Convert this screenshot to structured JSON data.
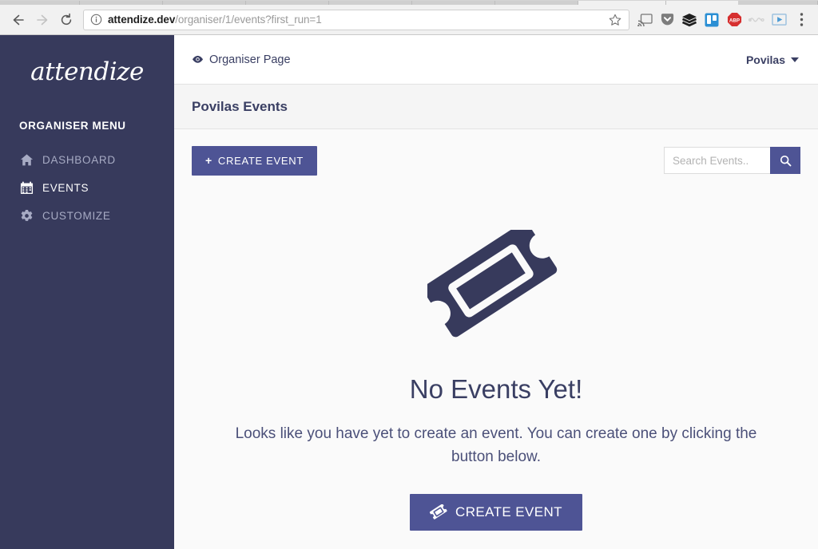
{
  "browser": {
    "back_label": "Back",
    "forward_label": "Forward",
    "reload_label": "Reload",
    "url_host": "attendize.dev",
    "url_path": "/organiser/1/events?first_run=1",
    "info_icon": "info-circle-icon",
    "bookmark_icon": "star-icon",
    "extensions": [
      {
        "name": "cast-icon",
        "label": "Cast"
      },
      {
        "name": "pocket-icon",
        "label": "Pocket"
      },
      {
        "name": "layers-icon",
        "label": "Layers"
      },
      {
        "name": "trello-icon",
        "label": "Trello"
      },
      {
        "name": "adblock-plus-icon",
        "label": "ABP"
      },
      {
        "name": "faded-extension-icon",
        "label": ""
      },
      {
        "name": "video-player-icon",
        "label": ""
      }
    ],
    "menu_icon": "three-dot-menu-icon"
  },
  "sidebar": {
    "logo": "attendize",
    "menu_heading": "ORGANISER MENU",
    "items": [
      {
        "label": "DASHBOARD",
        "icon": "home-icon",
        "active": false
      },
      {
        "label": "EVENTS",
        "icon": "calendar-icon",
        "active": true
      },
      {
        "label": "CUSTOMIZE",
        "icon": "gear-icon",
        "active": false
      }
    ]
  },
  "topbar": {
    "organiser_page_label": "Organiser Page",
    "organiser_page_icon": "eye-icon",
    "user_name": "Povilas",
    "user_caret_icon": "caret-down-icon"
  },
  "page": {
    "title": "Povilas Events"
  },
  "toolbar": {
    "create_event_label": "CREATE EVENT",
    "create_event_icon": "plus-icon",
    "search_placeholder": "Search Events..",
    "search_value": "",
    "search_button_icon": "search-icon"
  },
  "empty_state": {
    "icon": "ticket-icon",
    "title": "No Events Yet!",
    "description": "Looks like you have yet to create an event. You can create one by clicking the button below.",
    "cta_label": "CREATE EVENT",
    "cta_icon": "ticket-icon"
  },
  "colors": {
    "sidebar_bg": "#373a5c",
    "accent_purple": "#4e5495",
    "text_navy": "#3a3f63",
    "content_bg": "#fafafa",
    "title_band_bg": "#f5f5f5",
    "adblock_red": "#d63030",
    "trello_blue": "#2b8fd4"
  }
}
